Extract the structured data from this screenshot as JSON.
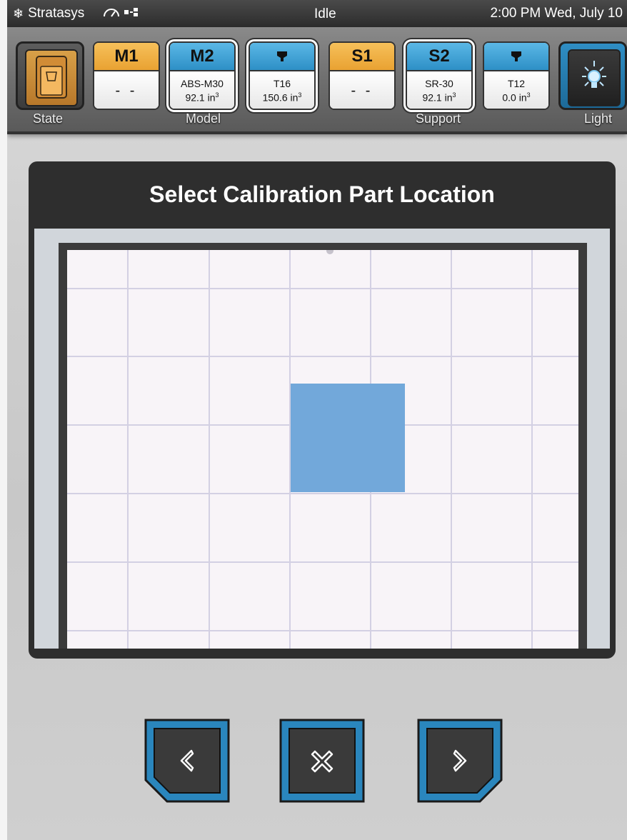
{
  "status": {
    "brand": "Stratasys",
    "state_text": "Idle",
    "datetime": "2:00 PM Wed, July 10"
  },
  "materials": {
    "state_label": "State",
    "model_label": "Model",
    "support_label": "Support",
    "light_label": "Light",
    "bays": [
      {
        "id": "M1",
        "material": "- -",
        "volume": ""
      },
      {
        "id": "M2",
        "material": "ABS-M30",
        "volume": "92.1 in",
        "sup": "3"
      },
      {
        "id": "model-tip",
        "material": "T16",
        "volume": "150.6 in",
        "sup": "3"
      },
      {
        "id": "S1",
        "material": "- -",
        "volume": ""
      },
      {
        "id": "S2",
        "material": "SR-30",
        "volume": "92.1 in",
        "sup": "3"
      },
      {
        "id": "support-tip",
        "material": "T12",
        "volume": "0.0 in",
        "sup": "3"
      }
    ]
  },
  "panel": {
    "title": "Select Calibration Part Location"
  },
  "nav": {
    "back": "back-icon",
    "cancel": "close-icon",
    "next": "forward-icon"
  },
  "colors": {
    "model_orange": "#e9a232",
    "support_blue": "#2d8fc6",
    "calibration_part": "#72a8da",
    "button_blue": "#2a86bd"
  }
}
